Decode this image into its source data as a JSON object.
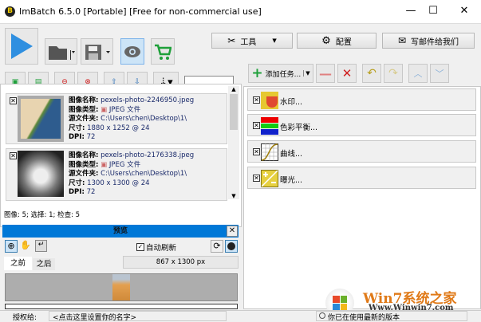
{
  "window": {
    "title": "ImBatch 6.5.0 [Portable] [Free for non-commercial use]",
    "logo_letter": "B",
    "minimize": "—",
    "maximize": "☐",
    "close": "✕"
  },
  "toolbar": {
    "tools_label": "工具",
    "settings_label": "配置",
    "email_label": "写邮件给我们"
  },
  "right_toolbar": {
    "add_task_label": "添加任务..."
  },
  "images": [
    {
      "name_label": "图像名称:",
      "name": "pexels-photo-2246950.jpeg",
      "type_label": "图像类型:",
      "type": "JPEG 文件",
      "folder_label": "源文件夹:",
      "folder": "C:\\Users\\chen\\Desktop\\1\\",
      "size_label": "尺寸:",
      "size": "1880 x 1252 @ 24",
      "dpi_label": "DPI:",
      "dpi": "72"
    },
    {
      "name_label": "图像名称:",
      "name": "pexels-photo-2176338.jpeg",
      "type_label": "图像类型:",
      "type": "JPEG 文件",
      "folder_label": "源文件夹:",
      "folder": "C:\\Users\\chen\\Desktop\\1\\",
      "size_label": "尺寸:",
      "size": "1300 x 1300 @ 24",
      "dpi_label": "DPI:",
      "dpi": "72"
    }
  ],
  "image_status": "图像: 5; 选择: 1; 检查: 5",
  "preview": {
    "title": "预览",
    "auto_refresh": "自动刷新",
    "tab_before": "之前",
    "tab_after": "之后",
    "dimensions": "867 x 1300 px"
  },
  "tasks": [
    {
      "label": "水印..."
    },
    {
      "label": "色彩平衡..."
    },
    {
      "label": "曲线..."
    },
    {
      "label": "曝光..."
    }
  ],
  "statusbar": {
    "license_label": "授权给:",
    "license_value": "<点击这里设置你的名字>",
    "version_status": "你已在使用最新的版本"
  },
  "watermark": {
    "text": "Win7系统之家",
    "url": "Www.Winwin7.com"
  }
}
